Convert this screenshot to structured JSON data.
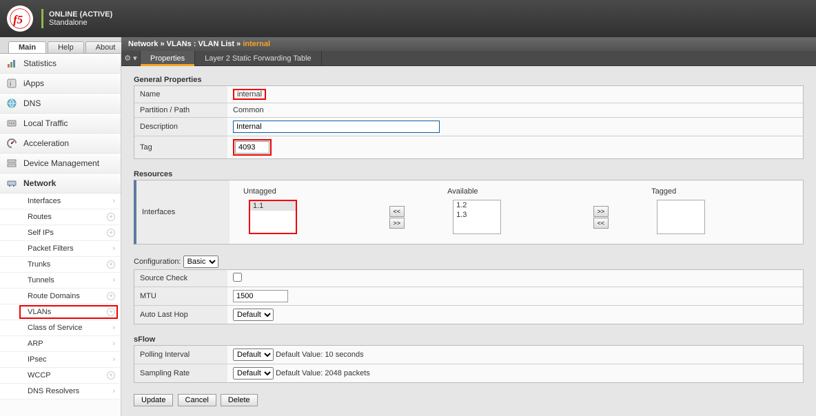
{
  "header": {
    "status": "ONLINE (ACTIVE)",
    "mode": "Standalone"
  },
  "side_tabs": {
    "main": "Main",
    "help": "Help",
    "about": "About",
    "active": "main"
  },
  "nav": [
    {
      "id": "statistics",
      "label": "Statistics"
    },
    {
      "id": "iapps",
      "label": "iApps"
    },
    {
      "id": "dns",
      "label": "DNS"
    },
    {
      "id": "local-traffic",
      "label": "Local Traffic"
    },
    {
      "id": "acceleration",
      "label": "Acceleration"
    },
    {
      "id": "device-management",
      "label": "Device Management"
    },
    {
      "id": "network",
      "label": "Network",
      "open": true,
      "items": [
        {
          "id": "interfaces",
          "label": "Interfaces",
          "arrow": true
        },
        {
          "id": "routes",
          "label": "Routes",
          "plus": true
        },
        {
          "id": "self-ips",
          "label": "Self IPs",
          "plus": true
        },
        {
          "id": "packet-filters",
          "label": "Packet Filters",
          "arrow": true
        },
        {
          "id": "trunks",
          "label": "Trunks",
          "plus": true
        },
        {
          "id": "tunnels",
          "label": "Tunnels",
          "arrow": true
        },
        {
          "id": "route-domains",
          "label": "Route Domains",
          "plus": true
        },
        {
          "id": "vlans",
          "label": "VLANs",
          "plus": true,
          "selected": true
        },
        {
          "id": "class-of-service",
          "label": "Class of Service",
          "arrow": true
        },
        {
          "id": "arp",
          "label": "ARP",
          "arrow": true
        },
        {
          "id": "ipsec",
          "label": "IPsec",
          "arrow": true
        },
        {
          "id": "wccp",
          "label": "WCCP",
          "plus": true
        },
        {
          "id": "dns-resolvers",
          "label": "DNS Resolvers",
          "arrow": true
        }
      ]
    }
  ],
  "breadcrumbs": {
    "a": "Network",
    "b": "VLANs : VLAN List",
    "cur": "internal"
  },
  "page_tabs": {
    "active": "Properties",
    "other": "Layer 2 Static Forwarding Table"
  },
  "general": {
    "heading": "General Properties",
    "rows": {
      "name_label": "Name",
      "name_value": "internal",
      "partition_label": "Partition / Path",
      "partition_value": "Common",
      "description_label": "Description",
      "description_value": "Internal",
      "tag_label": "Tag",
      "tag_value": "4093"
    }
  },
  "resources": {
    "heading": "Resources",
    "interfaces_label": "Interfaces",
    "untagged_label": "Untagged",
    "available_label": "Available",
    "tagged_label": "Tagged",
    "untagged": [
      "1.1"
    ],
    "available": [
      "1.2",
      "1.3"
    ],
    "tagged": []
  },
  "configuration": {
    "label": "Configuration:",
    "level": "Basic",
    "source_check_label": "Source Check",
    "source_check": false,
    "mtu_label": "MTU",
    "mtu": "1500",
    "auto_last_hop_label": "Auto Last Hop",
    "auto_last_hop": "Default"
  },
  "sflow": {
    "heading": "sFlow",
    "polling_label": "Polling Interval",
    "polling_value": "Default",
    "polling_hint": "Default Value: 10 seconds",
    "sampling_label": "Sampling Rate",
    "sampling_value": "Default",
    "sampling_hint": "Default Value: 2048 packets"
  },
  "buttons": {
    "update": "Update",
    "cancel": "Cancel",
    "delete": "Delete"
  }
}
